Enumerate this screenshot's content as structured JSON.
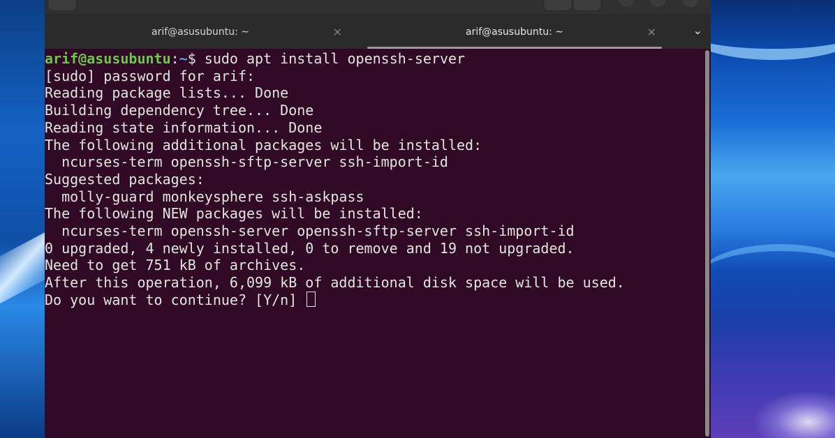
{
  "tabs": [
    {
      "title": "arif@asusubuntu: ~",
      "close": "×"
    },
    {
      "title": "arif@asusubuntu: ~",
      "close": "×"
    }
  ],
  "tab_menu_glyph": "⌄",
  "terminal": {
    "prompt_user": "arif@asusubuntu",
    "prompt_sep": ":",
    "prompt_path": "~",
    "prompt_symbol": "$",
    "command": " sudo apt install openssh-server",
    "output": [
      "[sudo] password for arif:",
      "Reading package lists... Done",
      "Building dependency tree... Done",
      "Reading state information... Done",
      "The following additional packages will be installed:",
      "  ncurses-term openssh-sftp-server ssh-import-id",
      "Suggested packages:",
      "  molly-guard monkeysphere ssh-askpass",
      "The following NEW packages will be installed:",
      "  ncurses-term openssh-server openssh-sftp-server ssh-import-id",
      "0 upgraded, 4 newly installed, 0 to remove and 19 not upgraded.",
      "Need to get 751 kB of archives.",
      "After this operation, 6,099 kB of additional disk space will be used."
    ],
    "question": "Do you want to continue? [Y/n] "
  },
  "colors": {
    "terminal_bg": "#300a24",
    "prompt_user": "#6ec64c",
    "prompt_path": "#6c9bd6",
    "text": "#e4e4e4"
  }
}
